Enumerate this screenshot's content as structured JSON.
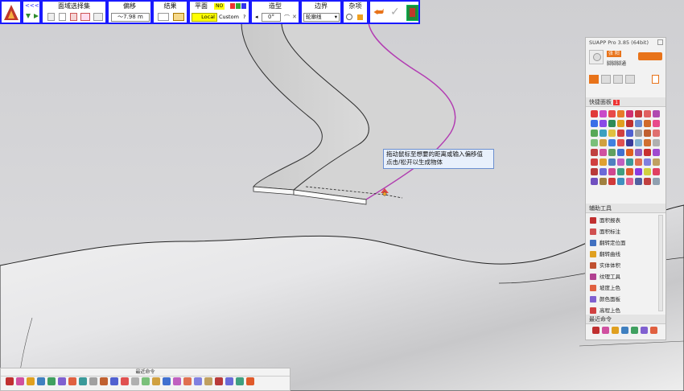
{
  "toolbar": {
    "nav_arrows": "<<<",
    "region_select": {
      "title": "面域选择集"
    },
    "offset": {
      "title": "偏移",
      "value": "～7.98 m"
    },
    "result": {
      "title": "结果"
    },
    "plane": {
      "title": "平面",
      "no_label": "NO",
      "local_label": "Local",
      "custom_label": "Custom",
      "help": "?"
    },
    "shape": {
      "title": "造型",
      "angle": "0°"
    },
    "border": {
      "title": "边界",
      "selected": "轮廓线"
    },
    "misc": {
      "title": "杂项"
    }
  },
  "tooltip": {
    "line1": "拖动鼠标至想要的距离或输入偏移值",
    "line2": "点击/松开以生成物体"
  },
  "suapp": {
    "title": "SUAPP Pro 3.85 (64bit)",
    "user_name": "张 阳",
    "user_sub": "脚脚脚通",
    "quick_panel": "快捷面板",
    "quick_badge": "1",
    "aux_tools": "辅助工具",
    "aux_items": [
      "面积报表",
      "面积标注",
      "翻转定位面",
      "翻转曲线",
      "实体体积",
      "纹理工具",
      "坡度上色",
      "颜色面板",
      "高程上色"
    ],
    "recent": "最近命令",
    "colors": {
      "accent": "#e8731a",
      "header": "#e4e4e4"
    }
  },
  "bottombar": {
    "title": "最近命令"
  },
  "colors": {
    "toolbar_border": "#1a1aff",
    "selection": "#b43cb4"
  }
}
